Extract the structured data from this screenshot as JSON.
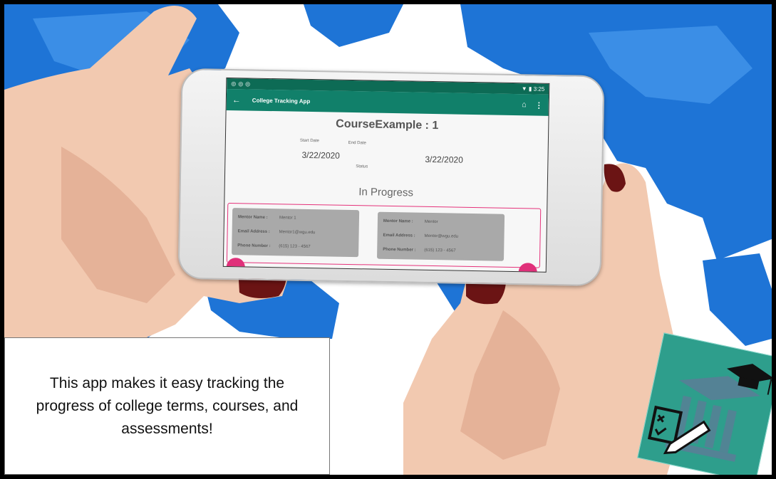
{
  "phone": {
    "status_time": "3:25",
    "app_title": "College Tracking App",
    "course_title": "CourseExample : 1",
    "start_label": "Start Date",
    "end_label": "End Date",
    "start_date": "3/22/2020",
    "end_date": "3/22/2020",
    "status_label": "Status",
    "status_value": "In Progress",
    "mentors": [
      {
        "name_label": "Mentor Name :",
        "name": "Mentor 1",
        "email_label": "Email Address :",
        "email": "Mentor1@wgu.edu",
        "phone_label": "Phone Number :",
        "phone": "(615) 123 - 4567"
      },
      {
        "name_label": "Mentor Name :",
        "name": "Mentor",
        "email_label": "Email Address :",
        "email": "Mentor@wgu.edu",
        "phone_label": "Phone Number :",
        "phone": "(615) 123 - 4567"
      }
    ]
  },
  "caption": {
    "text": "This app makes it easy tracking the progress of college terms, courses, and assessments!"
  },
  "icons": [
    "back-arrow-icon",
    "home-icon",
    "more-vert-icon",
    "wifi-icon",
    "battery-icon",
    "graduation-cap-icon",
    "building-icon",
    "checklist-icon",
    "pencil-icon"
  ],
  "colors": {
    "app_bar": "#11806a",
    "status_bar": "#0d6b55",
    "accent": "#e0307a",
    "logo_bg": "#2e9e8c",
    "map_blue": "#1e74d6"
  }
}
